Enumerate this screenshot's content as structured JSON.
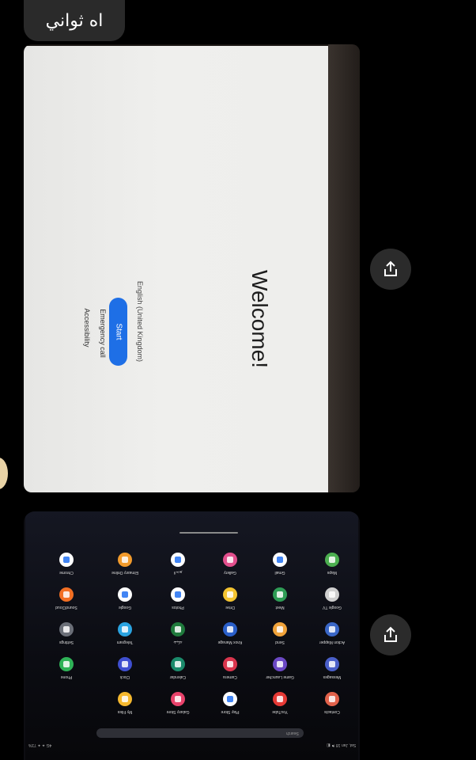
{
  "chat": {
    "reply_text": "اه ثواني"
  },
  "photo1": {
    "welcome_title": "Welcome!",
    "language": "English (United Kingdom)",
    "start_button": "Start",
    "emergency_call": "Emergency call",
    "accessibility": "Accessibility",
    "accent_color": "#1e6fe6"
  },
  "photo2": {
    "search_placeholder": "Search",
    "status_left": "4G ✦ ✦ 71%",
    "status_right": "Sat, Jan 18 ⚑ ◧",
    "apps": [
      {
        "label": "Maps",
        "color": "#4caf50",
        "icon": "maps-icon"
      },
      {
        "label": "Google TV",
        "color": "#cfcfcf",
        "icon": "google-tv-icon"
      },
      {
        "label": "Action Mapper",
        "color": "#3a67c7",
        "icon": "action-mapper-icon"
      },
      {
        "label": "Messages",
        "color": "#4a5fc9",
        "icon": "messages-icon"
      },
      {
        "label": "Contacts",
        "color": "#e2624b",
        "icon": "contacts-icon"
      },
      {
        "label": "Gmail",
        "color": "#ffffff",
        "icon": "gmail-icon"
      },
      {
        "label": "Meet",
        "color": "#2e9c55",
        "icon": "meet-icon"
      },
      {
        "label": "Send",
        "color": "#f0a33a",
        "icon": "send-icon"
      },
      {
        "label": "Game Launcher",
        "color": "#6b48c4",
        "icon": "game-launcher-icon"
      },
      {
        "label": "YouTube",
        "color": "#e53935",
        "icon": "youtube-icon"
      },
      {
        "label": "Gallery",
        "color": "#e24f8d",
        "icon": "gallery-icon"
      },
      {
        "label": "Drive",
        "color": "#f4c430",
        "icon": "drive-icon"
      },
      {
        "label": "Knox Manage",
        "color": "#2a5fc9",
        "icon": "knox-manage-icon"
      },
      {
        "label": "Camera",
        "color": "#d9354d",
        "icon": "camera-icon"
      },
      {
        "label": "Play Store",
        "color": "#ffffff",
        "icon": "play-store-icon"
      },
      {
        "label": "لابديو",
        "color": "#ffffff",
        "icon": "app-icon"
      },
      {
        "label": "Photos",
        "color": "#ffffff",
        "icon": "photos-icon"
      },
      {
        "label": "شبكة",
        "color": "#1f7a3c",
        "icon": "app-icon"
      },
      {
        "label": "Calendar",
        "color": "#1b8a6b",
        "icon": "calendar-icon"
      },
      {
        "label": "Galaxy Store",
        "color": "#e8426b",
        "icon": "galaxy-store-icon"
      },
      {
        "label": "Elmasry Online",
        "color": "#f29b2c",
        "icon": "elmasry-online-icon"
      },
      {
        "label": "Google",
        "color": "#ffffff",
        "icon": "google-icon"
      },
      {
        "label": "Telegram",
        "color": "#2aa3e0",
        "icon": "telegram-icon"
      },
      {
        "label": "Clock",
        "color": "#3f4fd0",
        "icon": "clock-icon"
      },
      {
        "label": "My Files",
        "color": "#f5b82e",
        "icon": "my-files-icon"
      },
      {
        "label": "Chrome",
        "color": "#ffffff",
        "icon": "chrome-icon"
      },
      {
        "label": "SoundCloud",
        "color": "#f26f23",
        "icon": "soundcloud-icon"
      },
      {
        "label": "Settings",
        "color": "#6b6f78",
        "icon": "settings-icon"
      },
      {
        "label": "Phone",
        "color": "#2fb257",
        "icon": "phone-icon"
      }
    ]
  }
}
